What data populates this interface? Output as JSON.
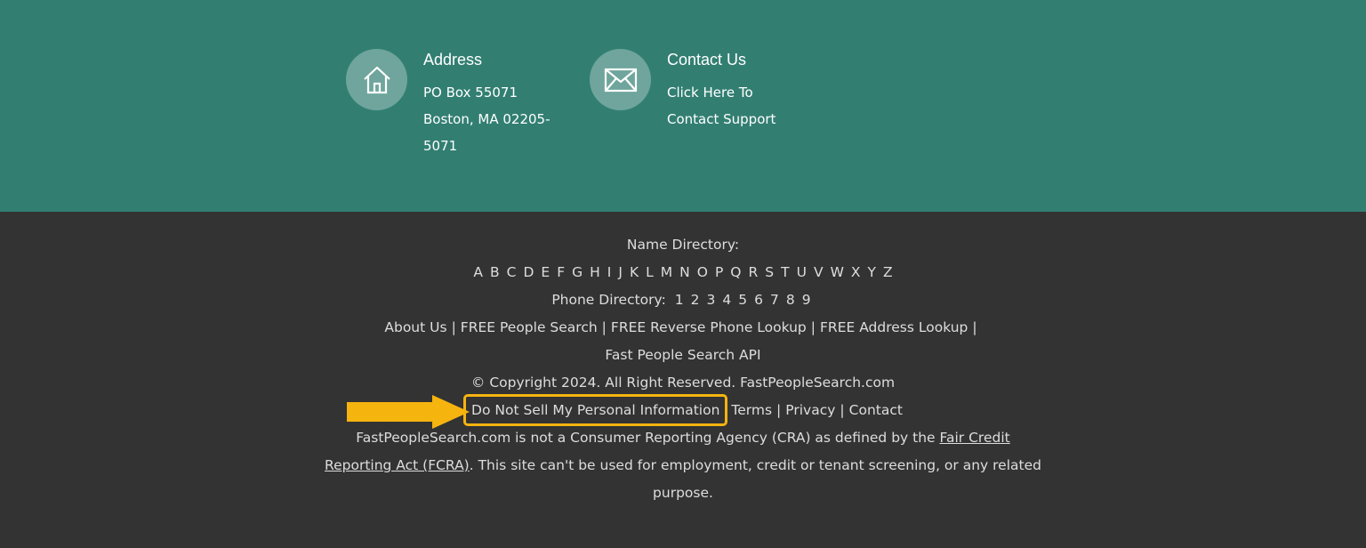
{
  "colors": {
    "top_bg": "#327f72",
    "bottom_bg": "#333333",
    "highlight": "#f6b40f",
    "text": "#dddddd"
  },
  "address": {
    "icon": "home-icon",
    "title": "Address",
    "lines": [
      "PO Box 55071",
      "Boston, MA 02205-",
      "5071"
    ]
  },
  "contact": {
    "icon": "envelope-icon",
    "title": "Contact Us",
    "lines": [
      "Click Here To",
      "Contact Support"
    ]
  },
  "name_directory": {
    "label": "Name Directory:",
    "letters": [
      "A",
      "B",
      "C",
      "D",
      "E",
      "F",
      "G",
      "H",
      "I",
      "J",
      "K",
      "L",
      "M",
      "N",
      "O",
      "P",
      "Q",
      "R",
      "S",
      "T",
      "U",
      "V",
      "W",
      "X",
      "Y",
      "Z"
    ]
  },
  "phone_directory": {
    "label": "Phone Directory:",
    "digits": [
      "1",
      "2",
      "3",
      "4",
      "5",
      "6",
      "7",
      "8",
      "9"
    ]
  },
  "links": {
    "about": "About Us",
    "people_search": "FREE People Search",
    "reverse_phone": "FREE Reverse Phone Lookup",
    "address_lookup": "FREE Address Lookup",
    "api": "Fast People Search API"
  },
  "copyright": "© Copyright 2024. All Right Reserved. FastPeopleSearch.com",
  "legal_links": {
    "do_not_sell": "Do Not Sell My Personal Information",
    "terms": "Terms",
    "privacy": "Privacy",
    "contact": "Contact"
  },
  "disclaimer": {
    "prefix": "FastPeopleSearch.com is not a Consumer Reporting Agency (CRA) as defined by the ",
    "fcra_line1": "Fair Credit",
    "fcra_line2": "Reporting Act (FCRA)",
    "suffix": ". This site can't be used for employment, credit or tenant screening, or any related",
    "end": "purpose."
  },
  "separator": "|"
}
